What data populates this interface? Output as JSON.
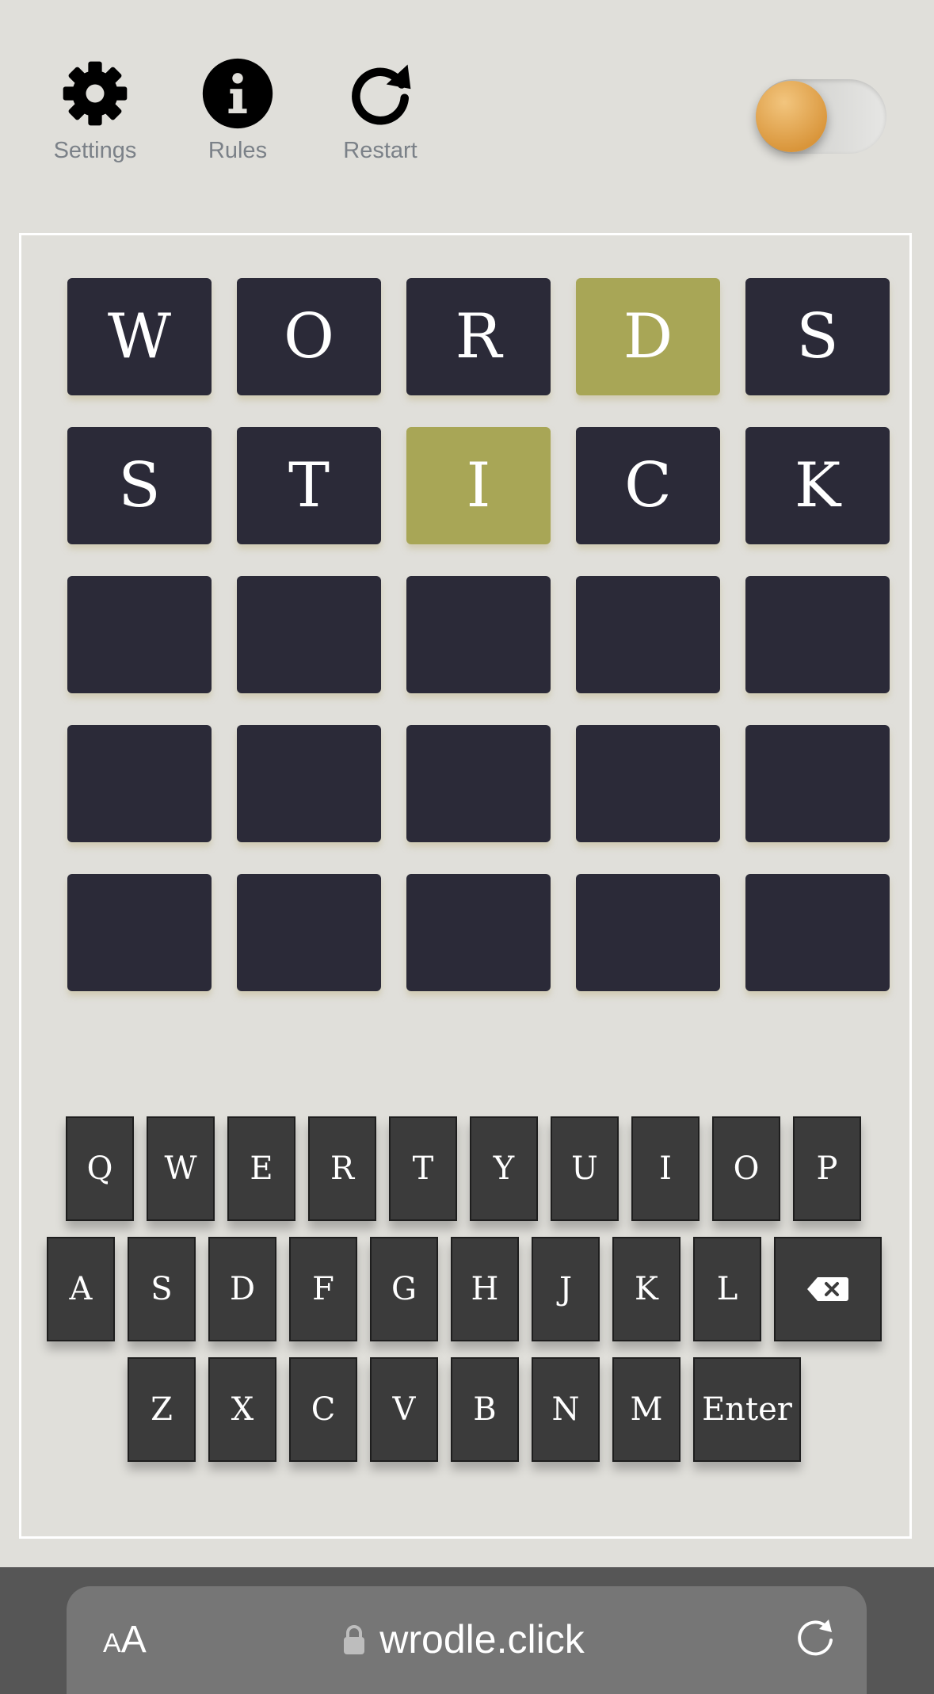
{
  "toolbar": {
    "settings_label": "Settings",
    "rules_label": "Rules",
    "restart_label": "Restart"
  },
  "theme_toggle": {
    "state": "off",
    "knob_color": "#d9953a"
  },
  "colors": {
    "background": "#e0dfda",
    "tile_empty": "#2b2a38",
    "tile_present": "#a8a656",
    "key": "#3b3b3b"
  },
  "board": {
    "rows": [
      [
        {
          "letter": "W",
          "state": "absent"
        },
        {
          "letter": "O",
          "state": "absent"
        },
        {
          "letter": "R",
          "state": "absent"
        },
        {
          "letter": "D",
          "state": "present"
        },
        {
          "letter": "S",
          "state": "absent"
        }
      ],
      [
        {
          "letter": "S",
          "state": "absent"
        },
        {
          "letter": "T",
          "state": "absent"
        },
        {
          "letter": "I",
          "state": "present"
        },
        {
          "letter": "C",
          "state": "absent"
        },
        {
          "letter": "K",
          "state": "absent"
        }
      ],
      [
        {
          "letter": "",
          "state": "empty"
        },
        {
          "letter": "",
          "state": "empty"
        },
        {
          "letter": "",
          "state": "empty"
        },
        {
          "letter": "",
          "state": "empty"
        },
        {
          "letter": "",
          "state": "empty"
        }
      ],
      [
        {
          "letter": "",
          "state": "empty"
        },
        {
          "letter": "",
          "state": "empty"
        },
        {
          "letter": "",
          "state": "empty"
        },
        {
          "letter": "",
          "state": "empty"
        },
        {
          "letter": "",
          "state": "empty"
        }
      ],
      [
        {
          "letter": "",
          "state": "empty"
        },
        {
          "letter": "",
          "state": "empty"
        },
        {
          "letter": "",
          "state": "empty"
        },
        {
          "letter": "",
          "state": "empty"
        },
        {
          "letter": "",
          "state": "empty"
        }
      ]
    ]
  },
  "keyboard": {
    "rows": [
      [
        "Q",
        "W",
        "E",
        "R",
        "T",
        "Y",
        "U",
        "I",
        "O",
        "P"
      ],
      [
        "A",
        "S",
        "D",
        "F",
        "G",
        "H",
        "J",
        "K",
        "L",
        "backspace-icon"
      ],
      [
        "Z",
        "X",
        "C",
        "V",
        "B",
        "N",
        "M",
        "Enter"
      ]
    ]
  },
  "browser": {
    "text_size_label_small": "A",
    "text_size_label_big": "A",
    "url": "wrodle.click"
  }
}
